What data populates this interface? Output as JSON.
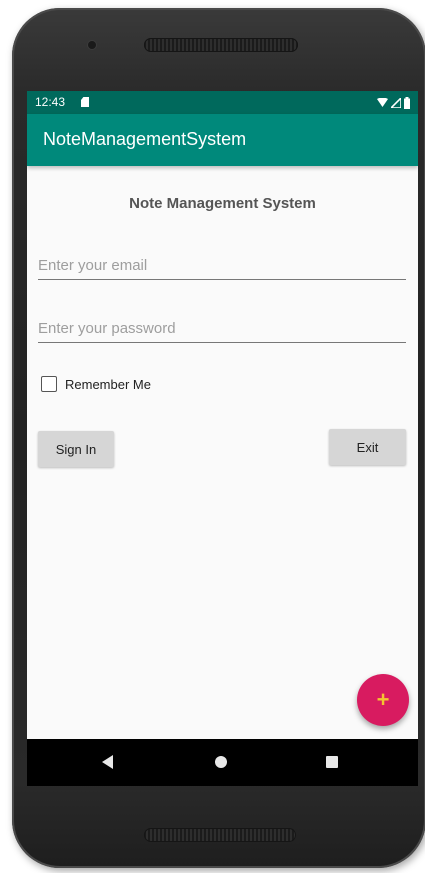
{
  "status_bar": {
    "time": "12:43",
    "icons": [
      "sd-card-icon",
      "wifi-icon",
      "signal-icon",
      "battery-icon"
    ]
  },
  "app_bar": {
    "title": "NoteManagementSystem"
  },
  "main": {
    "heading": "Note Management System",
    "email_placeholder": "Enter your email",
    "email_value": "",
    "password_placeholder": "Enter your password",
    "password_value": "",
    "remember_label": "Remember Me",
    "remember_checked": false,
    "sign_in_label": "Sign In",
    "exit_label": "Exit"
  },
  "fab": {
    "icon": "plus-icon",
    "glyph": "+"
  },
  "nav_bar": {
    "icons": [
      "back-icon",
      "home-icon",
      "recents-icon"
    ]
  },
  "colors": {
    "status_bar": "#00695c",
    "app_bar": "#00897b",
    "fab": "#d81b60",
    "fab_icon": "#f4c430",
    "button": "#d6d6d6"
  }
}
